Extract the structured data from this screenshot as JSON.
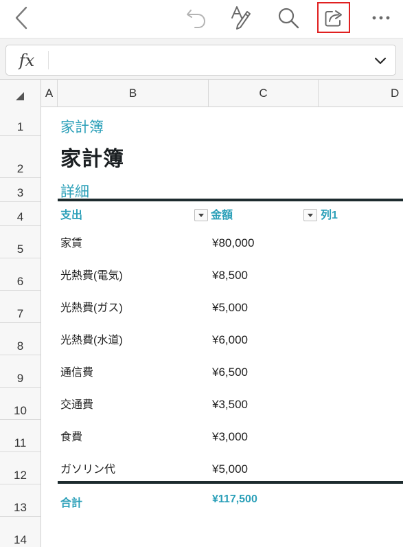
{
  "toolbar": {
    "icons": [
      "back-chevron-icon",
      "undo-icon",
      "draw-pen-icon",
      "search-icon",
      "share-icon",
      "more-icon"
    ]
  },
  "formula_bar": {
    "fx_label": "fx",
    "value": ""
  },
  "columns": [
    "A",
    "B",
    "C",
    "D"
  ],
  "rows": [
    "1",
    "2",
    "3",
    "4",
    "5",
    "6",
    "7",
    "8",
    "9",
    "10",
    "11",
    "12",
    "13",
    "14"
  ],
  "sheet": {
    "subtitle": "家計簿",
    "title": "家計簿",
    "section": "詳細",
    "table": {
      "headers": [
        "支出",
        "金額",
        "列1"
      ],
      "rows": [
        {
          "item": "家賃",
          "amount": "¥80,000"
        },
        {
          "item": "光熱費(電気)",
          "amount": "¥8,500"
        },
        {
          "item": "光熱費(ガス)",
          "amount": "¥5,000"
        },
        {
          "item": "光熱費(水道)",
          "amount": "¥6,000"
        },
        {
          "item": "通信費",
          "amount": "¥6,500"
        },
        {
          "item": "交通費",
          "amount": "¥3,500"
        },
        {
          "item": "食費",
          "amount": "¥3,000"
        },
        {
          "item": "ガソリン代",
          "amount": "¥5,000"
        }
      ],
      "total_label": "合計",
      "total_value": "¥117,500"
    }
  },
  "colors": {
    "accent": "#2a9fb8",
    "dark_rule": "#1d2b2e",
    "highlight_box": "#e02020"
  }
}
